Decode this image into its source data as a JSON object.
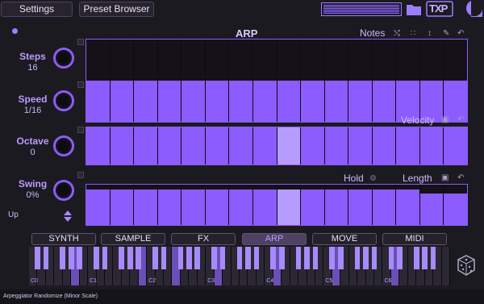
{
  "topbar": {
    "settings_label": "Settings",
    "preset_label": "Preset Browser",
    "logo_text": "TXP"
  },
  "left": {
    "steps": {
      "label": "Steps",
      "value": "16"
    },
    "speed": {
      "label": "Speed",
      "value": "1/16"
    },
    "octave": {
      "label": "Octave",
      "value": "0"
    },
    "swing": {
      "label": "Swing",
      "value": "0%"
    },
    "direction": "Up"
  },
  "arp": {
    "title": "ARP",
    "notes_label": "Notes",
    "notes_fill": [
      0.5,
      0.5,
      0.5,
      0.5,
      0.5,
      0.5,
      0.5,
      0.5,
      0.5,
      0.5,
      0.5,
      0.5,
      0.5,
      0.5,
      0.5,
      0.5
    ],
    "velocity_label": "Velocity",
    "velocity_fill": [
      1,
      1,
      1,
      1,
      1,
      1,
      1,
      1,
      1,
      1,
      1,
      1,
      1,
      1,
      1,
      1
    ],
    "velocity_highlight": 8,
    "hold_label": "Hold",
    "length_label": "Length",
    "length_fill": [
      0.88,
      0.88,
      0.88,
      0.88,
      0.88,
      0.88,
      0.88,
      0.88,
      0.88,
      0.88,
      0.88,
      0.88,
      0.88,
      0.88,
      0.78,
      0.78
    ],
    "length_highlight": 8
  },
  "tabs": [
    "SYNTH",
    "SAMPLE",
    "FX",
    "ARP",
    "MOVE",
    "MIDI"
  ],
  "active_tab": "ARP",
  "keyboard": {
    "octave_labels": [
      "C0",
      "C1",
      "C2",
      "C3",
      "C4",
      "C5",
      "C6"
    ]
  },
  "status_text": "Arpeggiator Randomize (Minor Scale)",
  "colors": {
    "accent": "#8c5cff",
    "highlight": "#b79cff",
    "background": "#1c1a21"
  }
}
